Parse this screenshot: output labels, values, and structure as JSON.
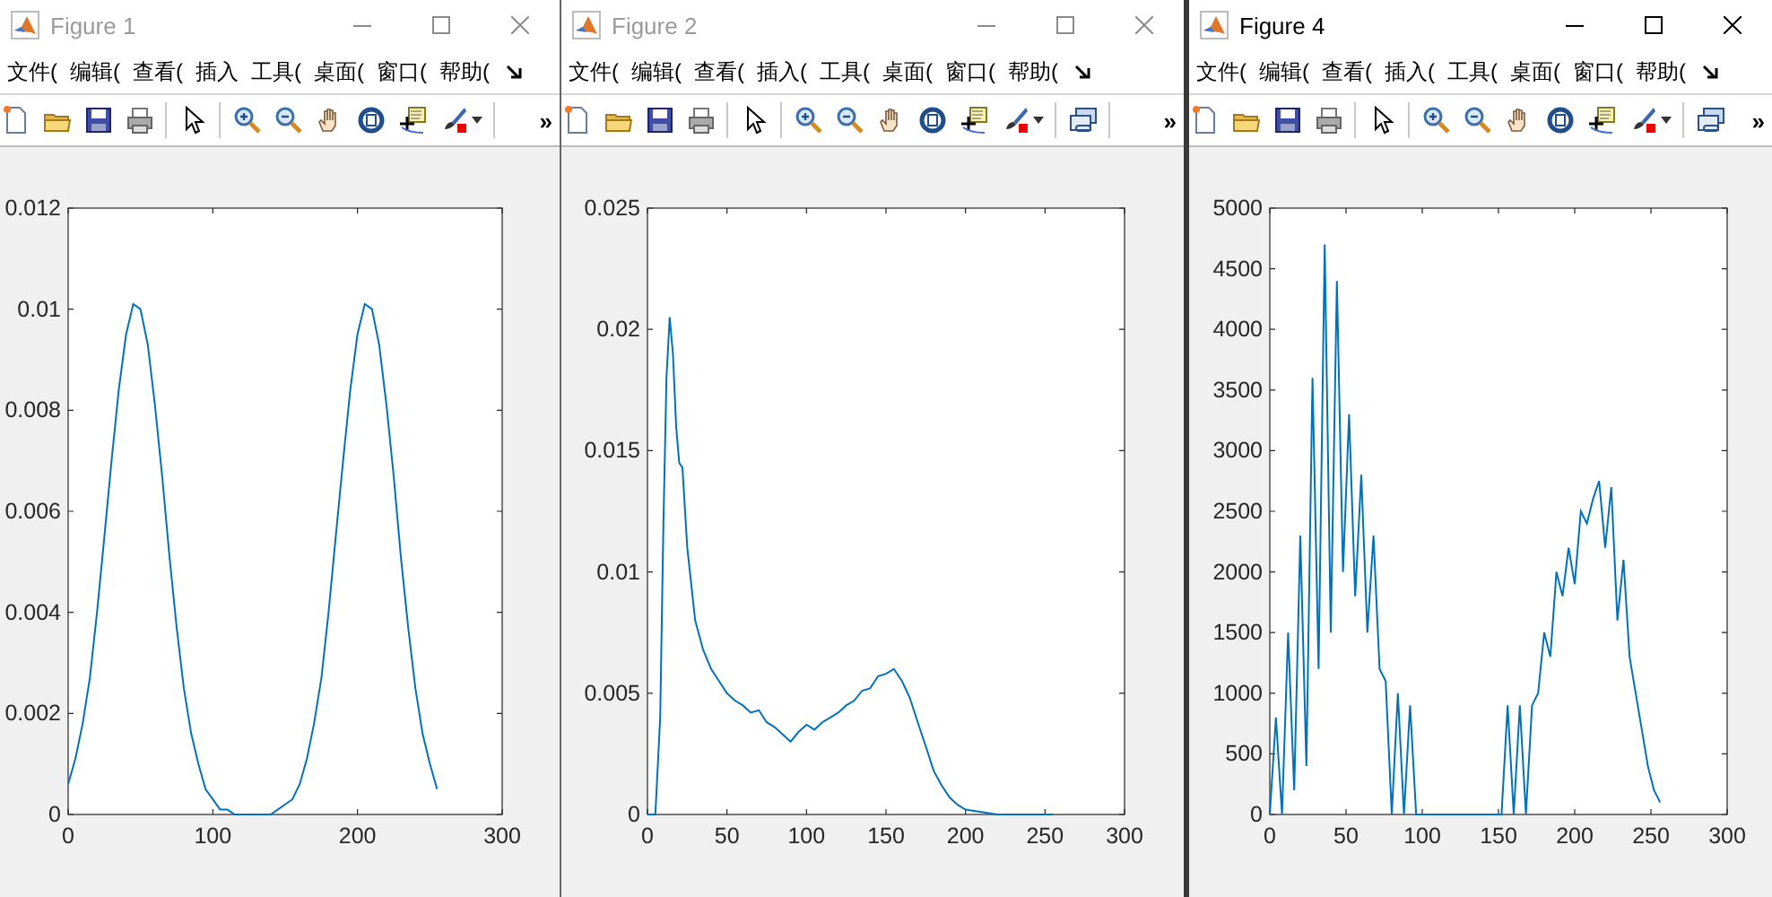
{
  "windows": [
    {
      "title": "Figure 1",
      "active": false,
      "menu": [
        "文件(",
        "编辑(",
        "查看(",
        "插入",
        "工具(",
        "桌面(",
        "窗口(",
        "帮助("
      ],
      "toolbar": [
        {
          "kind": "new"
        },
        {
          "kind": "open"
        },
        {
          "kind": "save"
        },
        {
          "kind": "print"
        },
        {
          "kind": "sep"
        },
        {
          "kind": "pointer"
        },
        {
          "kind": "sep"
        },
        {
          "kind": "zoom-in"
        },
        {
          "kind": "zoom-out"
        },
        {
          "kind": "pan"
        },
        {
          "kind": "rotate"
        },
        {
          "kind": "cursor"
        },
        {
          "kind": "brush"
        },
        {
          "kind": "sep"
        }
      ],
      "overflow": "»",
      "chart_data": {
        "type": "line",
        "xlim": [
          0,
          300
        ],
        "ylim": [
          0,
          0.012
        ],
        "xticks": [
          0,
          100,
          200,
          300
        ],
        "yticks": [
          0,
          0.002,
          0.004,
          0.006,
          0.008,
          0.01,
          0.012
        ],
        "x": [
          0,
          5,
          10,
          15,
          20,
          25,
          30,
          35,
          40,
          45,
          50,
          55,
          60,
          65,
          70,
          75,
          80,
          85,
          90,
          95,
          100,
          105,
          110,
          115,
          120,
          125,
          130,
          135,
          140,
          145,
          150,
          155,
          160,
          165,
          170,
          175,
          180,
          185,
          190,
          195,
          200,
          205,
          210,
          215,
          220,
          225,
          230,
          235,
          240,
          245,
          250,
          255
        ],
        "series": [
          {
            "color": "#0072bd",
            "values": [
              0.0006,
              0.0011,
              0.0018,
              0.0027,
              0.004,
              0.0055,
              0.007,
              0.0084,
              0.0095,
              0.0101,
              0.01,
              0.0093,
              0.0081,
              0.0067,
              0.0051,
              0.0037,
              0.0025,
              0.0016,
              0.001,
              0.0005,
              0.0003,
              0.0001,
              0.0001,
              0,
              0,
              0,
              0,
              0,
              0,
              0.0001,
              0.0002,
              0.0003,
              0.0006,
              0.0011,
              0.0018,
              0.0027,
              0.004,
              0.0055,
              0.007,
              0.0084,
              0.0095,
              0.0101,
              0.01,
              0.0093,
              0.0081,
              0.0067,
              0.0051,
              0.0037,
              0.0025,
              0.0016,
              0.001,
              0.0005
            ]
          }
        ]
      }
    },
    {
      "title": "Figure 2",
      "active": false,
      "menu": [
        "文件(",
        "编辑(",
        "查看(",
        "插入(",
        "工具(",
        "桌面(",
        "窗口(",
        "帮助("
      ],
      "toolbar": [
        {
          "kind": "new"
        },
        {
          "kind": "open"
        },
        {
          "kind": "save"
        },
        {
          "kind": "print"
        },
        {
          "kind": "sep"
        },
        {
          "kind": "pointer"
        },
        {
          "kind": "sep"
        },
        {
          "kind": "zoom-in"
        },
        {
          "kind": "zoom-out"
        },
        {
          "kind": "pan"
        },
        {
          "kind": "rotate"
        },
        {
          "kind": "cursor"
        },
        {
          "kind": "brush"
        },
        {
          "kind": "sep"
        },
        {
          "kind": "link"
        },
        {
          "kind": "sep"
        }
      ],
      "overflow": "»",
      "chart_data": {
        "type": "line",
        "xlim": [
          0,
          300
        ],
        "ylim": [
          0,
          0.025
        ],
        "xticks": [
          0,
          50,
          100,
          150,
          200,
          250,
          300
        ],
        "yticks": [
          0,
          0.005,
          0.01,
          0.015,
          0.02,
          0.025
        ],
        "x": [
          0,
          5,
          8,
          10,
          12,
          14,
          16,
          18,
          20,
          22,
          25,
          30,
          35,
          40,
          45,
          50,
          55,
          60,
          65,
          70,
          75,
          80,
          85,
          90,
          95,
          100,
          105,
          110,
          115,
          120,
          125,
          130,
          135,
          140,
          145,
          150,
          155,
          160,
          165,
          170,
          175,
          180,
          185,
          190,
          195,
          200,
          210,
          220,
          230,
          240,
          255
        ],
        "series": [
          {
            "color": "#0072bd",
            "values": [
              0,
              0,
              0.004,
              0.012,
              0.018,
              0.0205,
              0.019,
              0.016,
              0.0145,
              0.0143,
              0.011,
              0.008,
              0.0068,
              0.006,
              0.0055,
              0.005,
              0.0047,
              0.0045,
              0.0042,
              0.0043,
              0.0038,
              0.0036,
              0.0033,
              0.003,
              0.0034,
              0.0037,
              0.0035,
              0.0038,
              0.004,
              0.0042,
              0.0045,
              0.0047,
              0.0051,
              0.0052,
              0.0057,
              0.0058,
              0.006,
              0.0055,
              0.0048,
              0.0038,
              0.0028,
              0.0018,
              0.0012,
              0.0007,
              0.0004,
              0.0002,
              0.0001,
              0,
              0,
              0,
              0
            ]
          }
        ]
      }
    },
    {
      "title": "Figure 4",
      "active": true,
      "menu": [
        "文件(",
        "编辑(",
        "查看(",
        "插入(",
        "工具(",
        "桌面(",
        "窗口(",
        "帮助("
      ],
      "toolbar": [
        {
          "kind": "new"
        },
        {
          "kind": "open"
        },
        {
          "kind": "save"
        },
        {
          "kind": "print"
        },
        {
          "kind": "sep"
        },
        {
          "kind": "pointer"
        },
        {
          "kind": "sep"
        },
        {
          "kind": "zoom-in"
        },
        {
          "kind": "zoom-out"
        },
        {
          "kind": "pan"
        },
        {
          "kind": "rotate"
        },
        {
          "kind": "cursor"
        },
        {
          "kind": "brush"
        },
        {
          "kind": "sep"
        },
        {
          "kind": "link"
        }
      ],
      "overflow": "»",
      "chart_data": {
        "type": "line",
        "xlim": [
          0,
          300
        ],
        "ylim": [
          0,
          5000
        ],
        "xticks": [
          0,
          50,
          100,
          150,
          200,
          250,
          300
        ],
        "yticks": [
          0,
          500,
          1000,
          1500,
          2000,
          2500,
          3000,
          3500,
          4000,
          4500,
          5000
        ],
        "x": [
          0,
          4,
          8,
          12,
          16,
          20,
          24,
          28,
          32,
          36,
          40,
          44,
          48,
          52,
          56,
          60,
          64,
          68,
          72,
          76,
          80,
          84,
          88,
          92,
          96,
          100,
          104,
          108,
          112,
          116,
          120,
          124,
          128,
          132,
          136,
          140,
          144,
          148,
          152,
          156,
          160,
          164,
          168,
          172,
          176,
          180,
          184,
          188,
          192,
          196,
          200,
          204,
          208,
          212,
          216,
          220,
          224,
          228,
          232,
          236,
          240,
          244,
          248,
          252,
          256
        ],
        "series": [
          {
            "color": "#0072bd",
            "values": [
              0,
              800,
              0,
              1500,
              200,
              2300,
              400,
              3600,
              1200,
              4700,
              1500,
              4400,
              2000,
              3300,
              1800,
              2800,
              1500,
              2300,
              1200,
              1100,
              0,
              1000,
              0,
              900,
              0,
              0,
              0,
              0,
              0,
              0,
              0,
              0,
              0,
              0,
              0,
              0,
              0,
              0,
              0,
              900,
              0,
              900,
              0,
              900,
              1000,
              1500,
              1300,
              2000,
              1800,
              2200,
              1900,
              2500,
              2400,
              2600,
              2750,
              2200,
              2700,
              1600,
              2100,
              1300,
              1000,
              700,
              400,
              200,
              100
            ]
          }
        ]
      }
    }
  ]
}
